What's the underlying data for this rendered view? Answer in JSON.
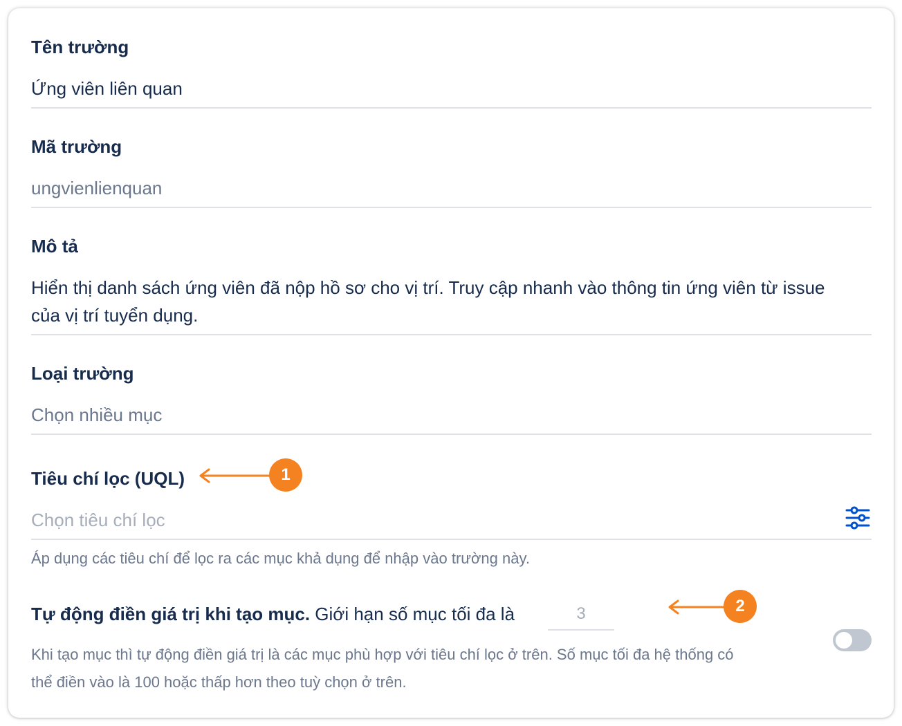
{
  "fields": {
    "name": {
      "label": "Tên trường",
      "value": "Ứng viên liên quan"
    },
    "key": {
      "label": "Mã trường",
      "value": "ungvienlienquan"
    },
    "description": {
      "label": "Mô tả",
      "value": "Hiển thị danh sách ứng viên đã nộp hồ sơ cho vị trí. Truy cập nhanh vào thông tin ứng viên từ issue của vị trí tuyển dụng."
    },
    "type": {
      "label": "Loại trường",
      "value": "Chọn nhiều mục"
    },
    "filter": {
      "label": "Tiêu chí lọc (UQL)",
      "placeholder": "Chọn tiêu chí lọc",
      "helper": "Áp dụng các tiêu chí để lọc ra các mục khả dụng để nhập vào trường này.",
      "icon": "filter-sliders-icon"
    },
    "autofill": {
      "label_bold": "Tự động điền giá trị khi tạo mục.",
      "label_rest": " Giới hạn số mục tối đa là",
      "limit_placeholder": "3",
      "helper": "Khi tạo mục thì tự động điền giá trị là các mục phù hợp với tiêu chí lọc ở trên. Số mục tối đa hệ thống có thể điền vào là 100 hoặc thấp hơn theo tuỳ chọn ở trên.",
      "toggle_on": false
    }
  },
  "annotations": [
    {
      "number": "1",
      "color": "#f58220"
    },
    {
      "number": "2",
      "color": "#f58220"
    }
  ],
  "colors": {
    "text": "#172b4d",
    "muted": "#6b778c",
    "placeholder": "#a5adba",
    "divider": "#dfe1e6",
    "accent_icon": "#0052cc",
    "annotation": "#f58220"
  }
}
